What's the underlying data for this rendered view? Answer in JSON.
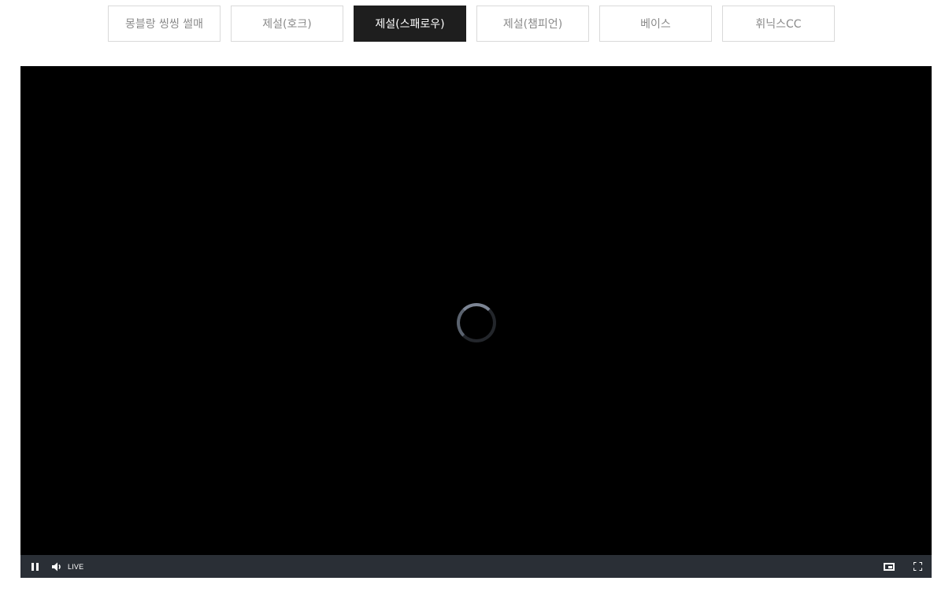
{
  "tabs": [
    {
      "label": "몽블랑 씽씽 썰매",
      "active": false
    },
    {
      "label": "제설(호크)",
      "active": false
    },
    {
      "label": "제설(스패로우)",
      "active": true
    },
    {
      "label": "제설(챔피언)",
      "active": false
    },
    {
      "label": "베이스",
      "active": false
    },
    {
      "label": "휘닉스CC",
      "active": false
    }
  ],
  "player": {
    "status": "loading",
    "live_label": "LIVE",
    "icons": [
      "pause-icon",
      "volume-icon",
      "picture-in-picture-icon",
      "fullscreen-icon"
    ]
  },
  "colors": {
    "active_tab_bg": "#1e1e1e",
    "control_bar_bg": "#2a2f36",
    "video_bg": "#000000"
  }
}
